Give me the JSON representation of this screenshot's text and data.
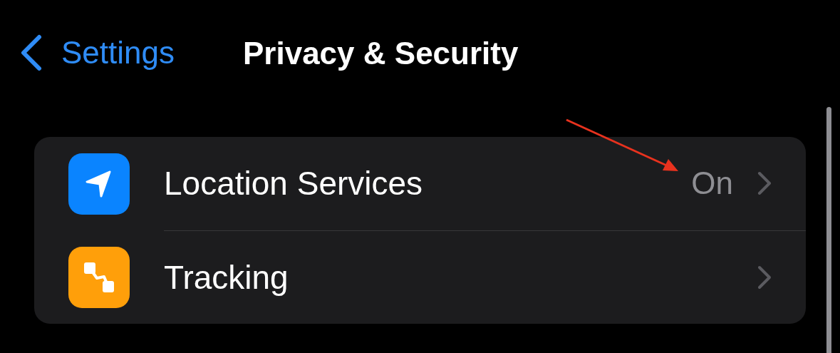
{
  "nav": {
    "back_label": "Settings",
    "title": "Privacy & Security"
  },
  "rows": [
    {
      "label": "Location Services",
      "value": "On",
      "color": "#0a84ff"
    },
    {
      "label": "Tracking",
      "color": "#ff9f0a"
    }
  ]
}
